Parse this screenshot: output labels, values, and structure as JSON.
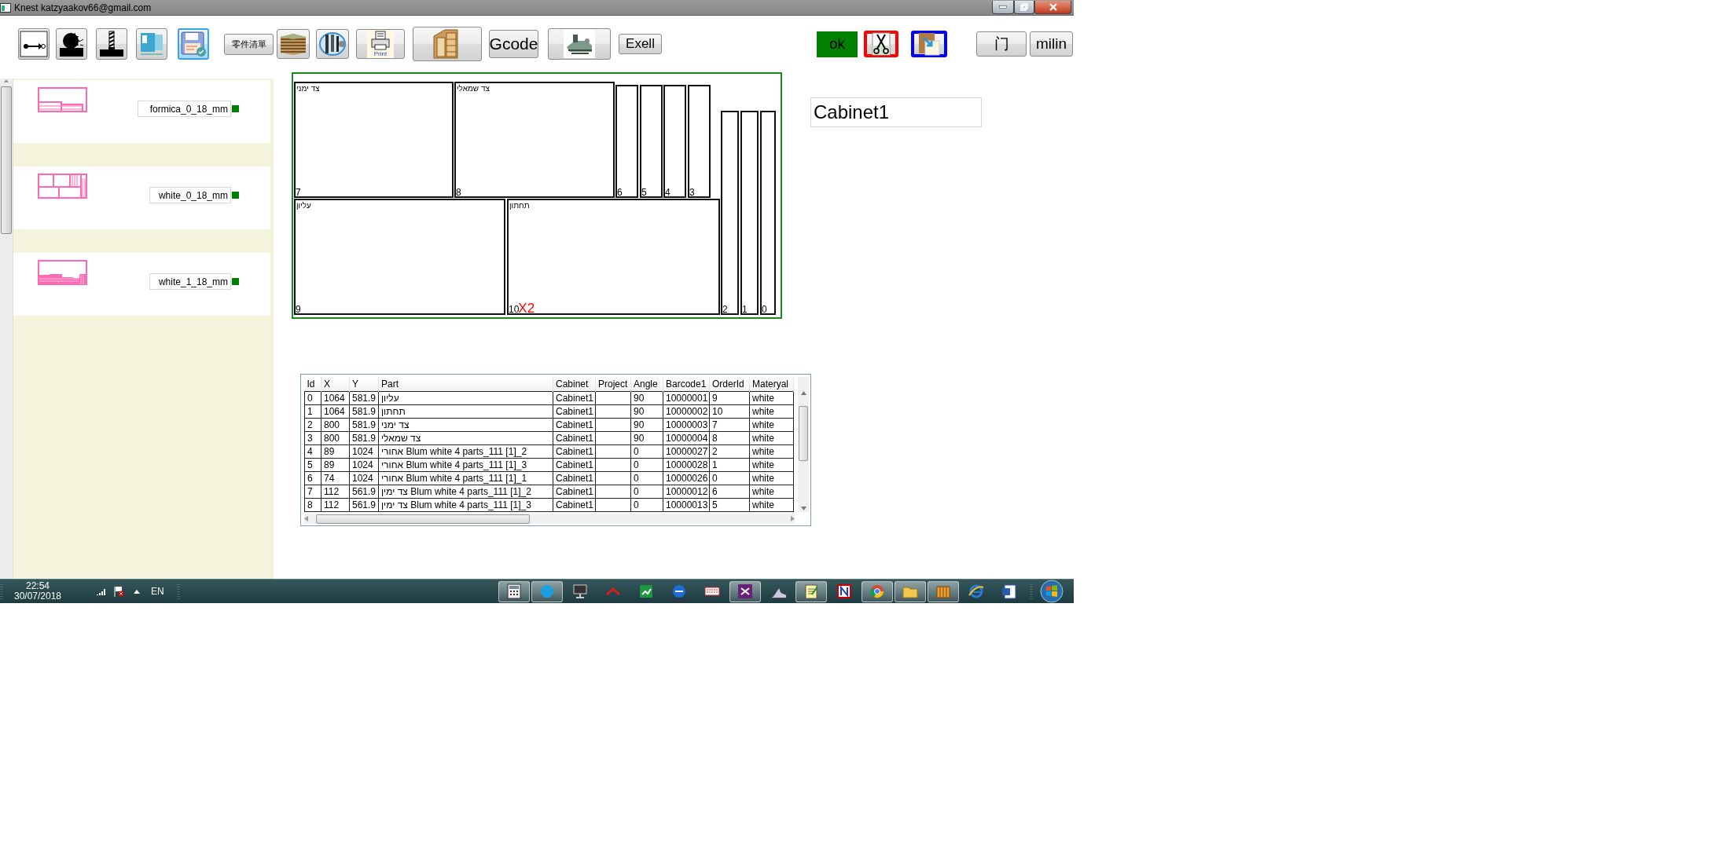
{
  "window": {
    "title": "Knest katzyaakov66@gmail.com"
  },
  "toolbar": {
    "buttons": [
      {
        "kind": "icon",
        "selected": false
      },
      {
        "kind": "icon",
        "selected": false
      },
      {
        "kind": "icon",
        "selected": false
      },
      {
        "kind": "icon",
        "selected": false
      },
      {
        "kind": "icon",
        "selected": true
      },
      {
        "kind": "text",
        "label": "零件清單",
        "selected": false
      },
      {
        "kind": "icon",
        "selected": false
      },
      {
        "kind": "icon",
        "selected": false
      },
      {
        "kind": "captioned",
        "caption": "Print",
        "selected": false
      },
      {
        "kind": "icon",
        "selected": false
      },
      {
        "kind": "text",
        "label": "Gcode",
        "selected": false
      },
      {
        "kind": "icon",
        "selected": false
      },
      {
        "kind": "text",
        "label": "Exell",
        "selected": false
      }
    ]
  },
  "status": {
    "label": "ok"
  },
  "tool_buttons": [
    {
      "kind": "icon"
    },
    {
      "kind": "icon"
    },
    {
      "kind": "text",
      "label": "门"
    },
    {
      "kind": "text",
      "label": "milin"
    }
  ],
  "materials": [
    {
      "name": "formica_0_18_mm"
    },
    {
      "name": "white_0_18_mm"
    },
    {
      "name": "white_1_18_mm"
    }
  ],
  "cabinet": {
    "value": "Cabinet1"
  },
  "layout": {
    "copies": "X2",
    "parts": [
      {
        "number": "7",
        "label": "צד ימני"
      },
      {
        "number": "8",
        "label": "צד שמאלי"
      },
      {
        "number": "6"
      },
      {
        "number": "5"
      },
      {
        "number": "4"
      },
      {
        "number": "3"
      },
      {
        "number": "9",
        "label": "עליון"
      },
      {
        "number": "10",
        "label": "תחתון"
      },
      {
        "number": "2"
      },
      {
        "number": "1"
      },
      {
        "number": "0"
      }
    ]
  },
  "parts_table": {
    "columns": [
      "Id",
      "X",
      "Y",
      "Part",
      "Cabinet",
      "Project",
      "Angle",
      "Barcode1",
      "OrderId",
      "Materyal"
    ],
    "rows": [
      [
        "0",
        "1064",
        "581.9",
        "עליון",
        "Cabinet1",
        "",
        "90",
        "10000001",
        "9",
        "white"
      ],
      [
        "1",
        "1064",
        "581.9",
        "תחתון",
        "Cabinet1",
        "",
        "90",
        "10000002",
        "10",
        "white"
      ],
      [
        "2",
        "800",
        "581.9",
        "צד ימני",
        "Cabinet1",
        "",
        "90",
        "10000003",
        "7",
        "white"
      ],
      [
        "3",
        "800",
        "581.9",
        "צד שמאלי",
        "Cabinet1",
        "",
        "90",
        "10000004",
        "8",
        "white"
      ],
      [
        "4",
        "89",
        "1024",
        "אחורי Blum white 4 parts_111 [1]_2",
        "Cabinet1",
        "",
        "0",
        "10000027",
        "2",
        "white"
      ],
      [
        "5",
        "89",
        "1024",
        "אחורי Blum white 4 parts_111 [1]_3",
        "Cabinet1",
        "",
        "0",
        "10000028",
        "1",
        "white"
      ],
      [
        "6",
        "74",
        "1024",
        "אחורי Blum white 4 parts_111 [1]_1",
        "Cabinet1",
        "",
        "0",
        "10000026",
        "0",
        "white"
      ],
      [
        "7",
        "112",
        "561.9",
        "צד ימין Blum white 4 parts_111 [1]_2",
        "Cabinet1",
        "",
        "0",
        "10000012",
        "6",
        "white"
      ],
      [
        "8",
        "112",
        "561.9",
        "צד ימין Blum white 4 parts_111 [1]_3",
        "Cabinet1",
        "",
        "0",
        "10000013",
        "5",
        "white"
      ]
    ]
  },
  "taskbar": {
    "time": "22:54",
    "date": "30/07/2018",
    "language": "EN"
  }
}
